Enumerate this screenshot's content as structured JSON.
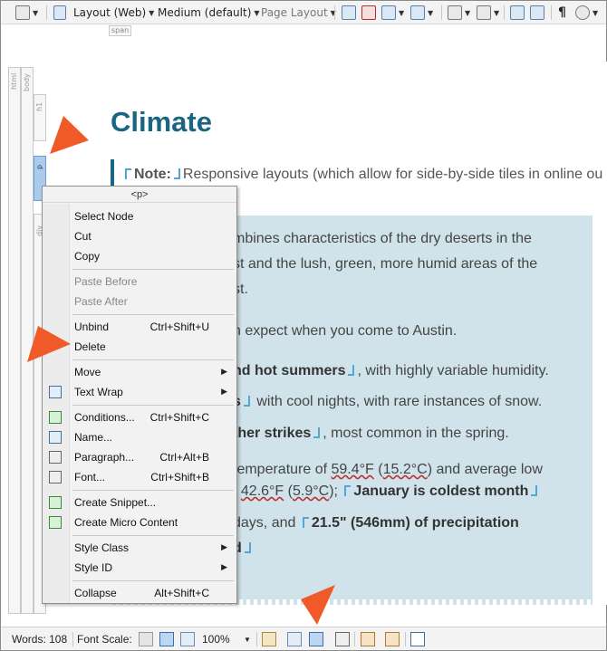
{
  "toolbar": {
    "layout": "Layout (Web)",
    "medium": "Medium (default)",
    "page_layout": "Page Layout"
  },
  "span_tag": "span",
  "structure": {
    "html": "html",
    "body": "body",
    "h1": "h1",
    "p": "p",
    "div": "div"
  },
  "document": {
    "title": "Climate",
    "note_label": "Note:",
    "note_text": "Responsive layouts (which allow for side-by-side tiles in online ou",
    "lines": [
      "mbines characteristics of the dry deserts in the",
      "st and the lush, green, more humid areas of the",
      "st.",
      "n expect when you come to Austin."
    ],
    "summers_bold": "nd hot summers",
    "summers_rest": ", with highly variable humidity.",
    "winter_bold": "s",
    "winter_rest": " with cool nights, with rare instances of snow.",
    "weather_bold": "ther strikes",
    "weather_rest": ", most common in the spring.",
    "temp_pre": " temperature of ",
    "temp_a": "59.4°F",
    "temp_mid": " (",
    "temp_b": "15.2°C",
    "temp_post": ") and average low",
    "low_pre": "f ",
    "low_a": "42.6°F",
    "low_mid": " (",
    "low_b": "5.9°C",
    "low_post": ");",
    "january_bold": "January is coldest month",
    "days_pre": " days, and ",
    "precip_bold": "21.5\" (546mm) of precipitation",
    "last_bold": "d"
  },
  "context_menu": {
    "header": "<p>",
    "groups": [
      [
        {
          "label": "Select Node",
          "shortcut": "",
          "disabled": false,
          "submenu": false,
          "icon": ""
        },
        {
          "label": "Cut",
          "shortcut": "",
          "disabled": false,
          "submenu": false,
          "icon": ""
        },
        {
          "label": "Copy",
          "shortcut": "",
          "disabled": false,
          "submenu": false,
          "icon": ""
        }
      ],
      [
        {
          "label": "Paste Before",
          "shortcut": "",
          "disabled": true,
          "submenu": false,
          "icon": ""
        },
        {
          "label": "Paste After",
          "shortcut": "",
          "disabled": true,
          "submenu": false,
          "icon": ""
        }
      ],
      [
        {
          "label": "Unbind",
          "shortcut": "Ctrl+Shift+U",
          "disabled": false,
          "submenu": false,
          "icon": ""
        },
        {
          "label": "Delete",
          "shortcut": "",
          "disabled": false,
          "submenu": false,
          "icon": ""
        }
      ],
      [
        {
          "label": "Move",
          "shortcut": "",
          "disabled": false,
          "submenu": true,
          "icon": ""
        },
        {
          "label": "Text Wrap",
          "shortcut": "",
          "disabled": false,
          "submenu": true,
          "icon": "text-wrap-icon"
        }
      ],
      [
        {
          "label": "Conditions...",
          "shortcut": "Ctrl+Shift+C",
          "disabled": false,
          "submenu": false,
          "icon": "conditions-icon"
        },
        {
          "label": "Name...",
          "shortcut": "",
          "disabled": false,
          "submenu": false,
          "icon": "name-icon"
        },
        {
          "label": "Paragraph...",
          "shortcut": "Ctrl+Alt+B",
          "disabled": false,
          "submenu": false,
          "icon": "paragraph-icon"
        },
        {
          "label": "Font...",
          "shortcut": "Ctrl+Shift+B",
          "disabled": false,
          "submenu": false,
          "icon": "font-icon"
        }
      ],
      [
        {
          "label": "Create Snippet...",
          "shortcut": "",
          "disabled": false,
          "submenu": false,
          "icon": "snippet-icon"
        },
        {
          "label": "Create Micro Content",
          "shortcut": "",
          "disabled": false,
          "submenu": false,
          "icon": "micro-content-icon"
        }
      ],
      [
        {
          "label": "Style Class",
          "shortcut": "",
          "disabled": false,
          "submenu": true,
          "icon": ""
        },
        {
          "label": "Style ID",
          "shortcut": "",
          "disabled": false,
          "submenu": true,
          "icon": ""
        }
      ],
      [
        {
          "label": "Collapse",
          "shortcut": "Alt+Shift+C",
          "disabled": false,
          "submenu": false,
          "icon": ""
        }
      ]
    ]
  },
  "status": {
    "words": "Words: 108",
    "font_scale": "Font Scale:",
    "zoom": "100%"
  },
  "colors": {
    "title": "#1a6582",
    "shaded": "#d0e3ea",
    "tag_marker": "#4ea7d8",
    "callout_arrow": "#f05a28"
  }
}
